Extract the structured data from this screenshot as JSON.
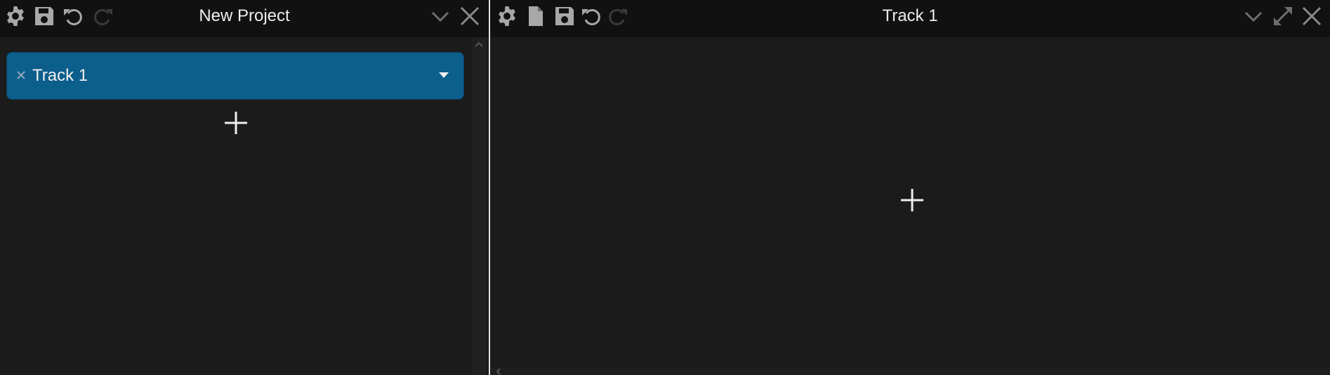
{
  "colors": {
    "titlebar_bg": "#111111",
    "panel_bg": "#1b1b1b",
    "accent": "#0c5e8b",
    "icon_active": "#a8a8a8",
    "icon_inactive": "#3a3a3a",
    "divider": "#e2e2e2"
  },
  "project_panel": {
    "title": "New Project",
    "toolbar_icons": [
      "gear-icon",
      "save-icon",
      "undo-icon",
      "redo-icon"
    ],
    "window_icons": [
      "chevron-down-icon",
      "close-icon"
    ],
    "tracks": [
      {
        "label": "Track 1"
      }
    ],
    "add_track_icon": "plus-icon"
  },
  "track_panel": {
    "title": "Track 1",
    "toolbar_icons": [
      "gear-icon",
      "file-icon",
      "save-icon",
      "undo-icon",
      "redo-icon"
    ],
    "window_icons": [
      "chevron-down-icon",
      "expand-icon",
      "close-icon"
    ],
    "add_clip_icon": "plus-icon"
  }
}
